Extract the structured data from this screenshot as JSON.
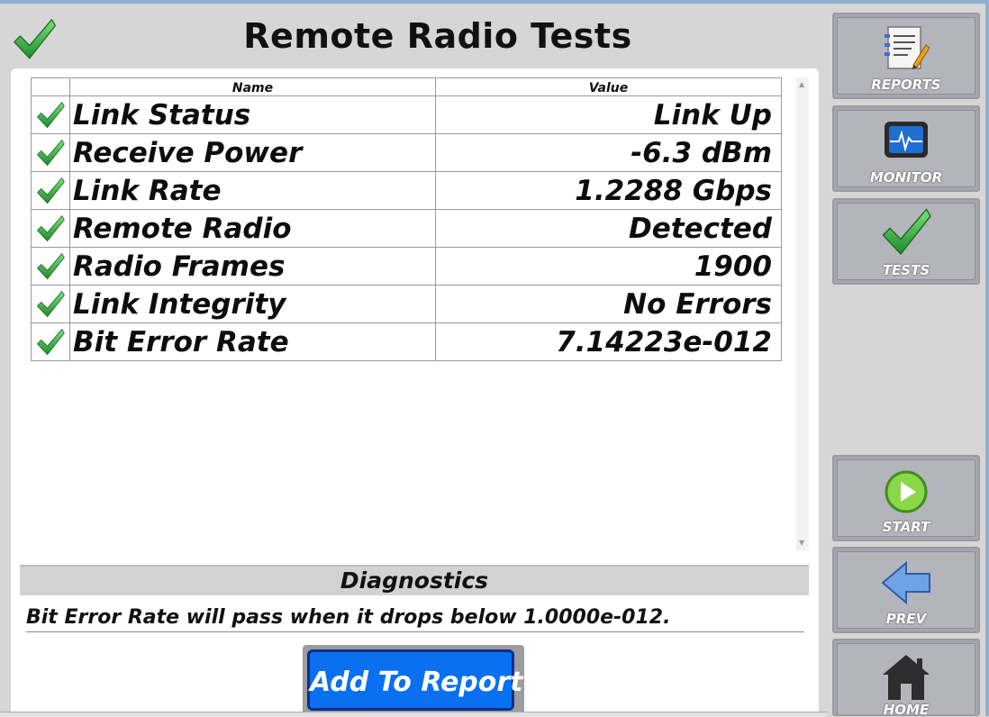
{
  "header": {
    "title": "Remote Radio Tests",
    "status_icon": "check-icon"
  },
  "table": {
    "columns": [
      "Name",
      "Value"
    ],
    "rows": [
      {
        "status": "pass",
        "name": "Link Status",
        "value": "Link Up"
      },
      {
        "status": "pass",
        "name": "Receive Power",
        "value": "-6.3 dBm"
      },
      {
        "status": "pass",
        "name": "Link Rate",
        "value": "1.2288 Gbps"
      },
      {
        "status": "pass",
        "name": "Remote Radio",
        "value": "Detected"
      },
      {
        "status": "pass",
        "name": "Radio Frames",
        "value": "1900"
      },
      {
        "status": "pass",
        "name": "Link Integrity",
        "value": "No Errors"
      },
      {
        "status": "pass",
        "name": "Bit Error Rate",
        "value": "7.14223e-012"
      }
    ]
  },
  "diagnostics": {
    "title": "Diagnostics",
    "message": "Bit Error Rate will pass when it drops below 1.0000e-012."
  },
  "actions": {
    "add_to_report": "Add To Report"
  },
  "sidebar": {
    "reports": "REPORTS",
    "monitor": "MONITOR",
    "tests": "TESTS",
    "start": "START",
    "prev": "PREV",
    "home": "HOME"
  },
  "colors": {
    "accent_button": "#0a6ff0",
    "pass_check": "#2e9c3a",
    "sidebar_button": "#b4b4bc"
  }
}
